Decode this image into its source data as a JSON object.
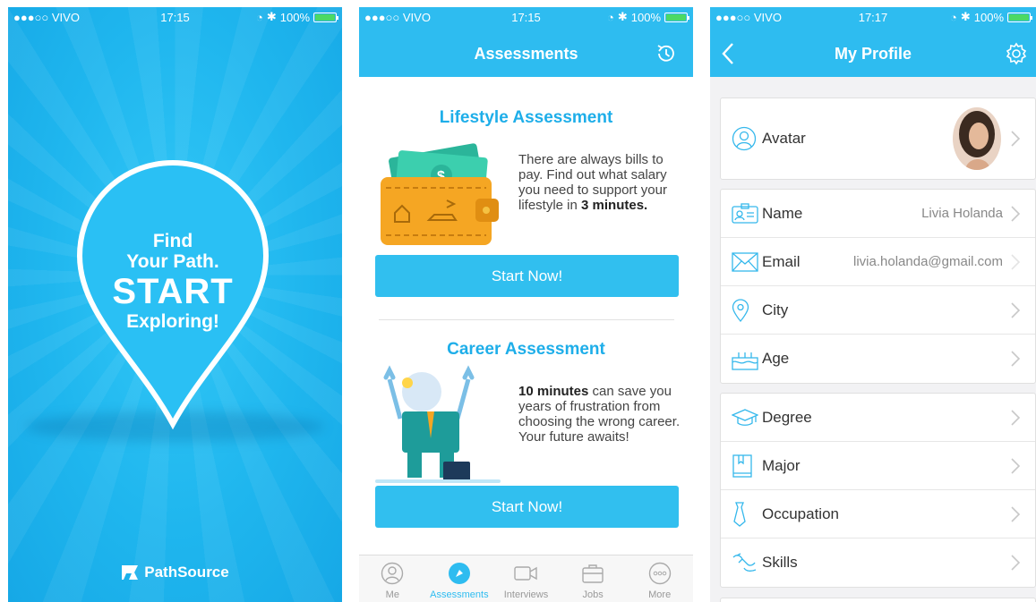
{
  "status_bars": [
    {
      "carrier": "●●●○○ VIVO",
      "time": "17:15",
      "battery": "100%"
    },
    {
      "carrier": "●●●○○ VIVO",
      "time": "17:15",
      "battery": "100%"
    },
    {
      "carrier": "●●●○○ VIVO",
      "time": "17:17",
      "battery": "100%"
    }
  ],
  "splash": {
    "line1": "Find",
    "line2": "Your Path.",
    "line3": "START",
    "line4": "Exploring!",
    "brand": "PathSource"
  },
  "assessments": {
    "title": "Assessments",
    "history_icon": "clock-history-icon",
    "lifestyle": {
      "title": "Lifestyle Assessment",
      "desc_pre": "There are always bills to pay. Find out what salary you need to support your lifestyle in ",
      "desc_bold": "3 minutes.",
      "button": "Start Now!"
    },
    "career": {
      "title": "Career Assessment",
      "desc_bold": "10 minutes",
      "desc_post": " can save you years of frustration from choosing the wrong career. Your future awaits!",
      "button": "Start Now!"
    },
    "tabs": [
      {
        "label": "Me",
        "icon": "person-icon"
      },
      {
        "label": "Assessments",
        "icon": "compass-icon"
      },
      {
        "label": "Interviews",
        "icon": "video-icon"
      },
      {
        "label": "Jobs",
        "icon": "briefcase-icon"
      },
      {
        "label": "More",
        "icon": "more-icon"
      }
    ]
  },
  "profile": {
    "title": "My Profile",
    "avatar_label": "Avatar",
    "rows1": [
      {
        "label": "Name",
        "value": "Livia Holanda",
        "icon": "id-card-icon"
      },
      {
        "label": "Email",
        "value": "livia.holanda@gmail.com",
        "icon": "envelope-icon"
      },
      {
        "label": "City",
        "value": "",
        "icon": "location-pin-icon"
      },
      {
        "label": "Age",
        "value": "",
        "icon": "birthday-cake-icon"
      }
    ],
    "rows2": [
      {
        "label": "Degree",
        "icon": "graduation-cap-icon"
      },
      {
        "label": "Major",
        "icon": "book-icon"
      },
      {
        "label": "Occupation",
        "icon": "tie-icon"
      },
      {
        "label": "Skills",
        "icon": "skills-icon"
      }
    ]
  },
  "colors": {
    "primary": "#2ebcf0",
    "button": "#31bfef",
    "title_blue": "#1eaee9"
  }
}
